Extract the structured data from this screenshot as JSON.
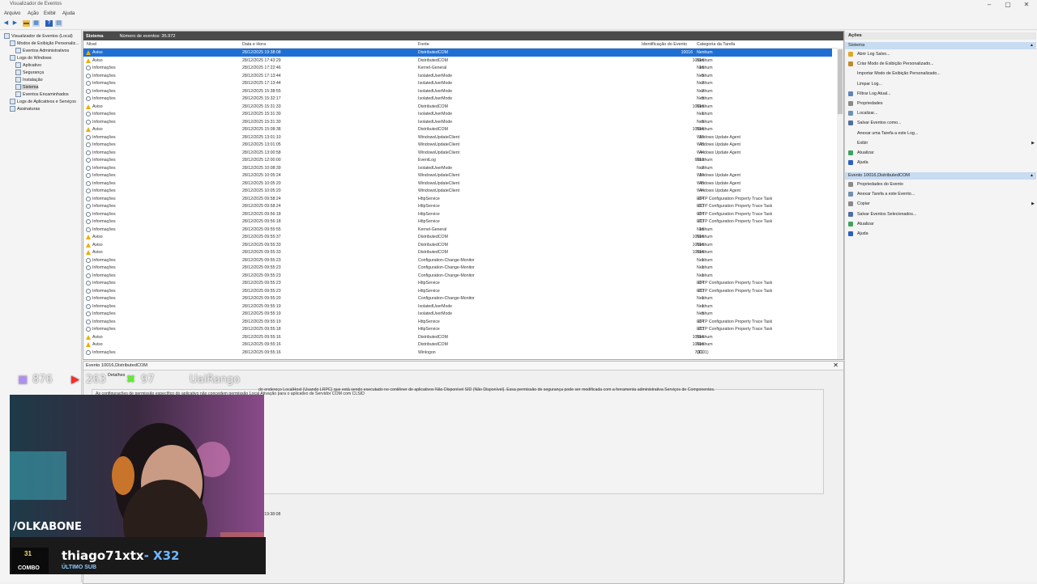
{
  "window": {
    "title": "Visualizador de Eventos",
    "controls": [
      "–",
      "▢",
      "✕"
    ]
  },
  "menu": [
    "Arquivo",
    "Ação",
    "Exibir",
    "Ajuda"
  ],
  "toolbar_icons": [
    "back-arrow-icon",
    "forward-arrow-icon",
    "folder-icon",
    "console-icon",
    "help-icon",
    "panel-icon"
  ],
  "tree": [
    {
      "label": "Visualizador de Eventos (Local)",
      "indent": 0,
      "sel": false
    },
    {
      "label": "Modos de Exibição Personaliz...",
      "indent": 1,
      "sel": false
    },
    {
      "label": "Eventos Administrativos",
      "indent": 2,
      "sel": false
    },
    {
      "label": "Logs do Windows",
      "indent": 1,
      "sel": false
    },
    {
      "label": "Aplicativo",
      "indent": 2,
      "sel": false
    },
    {
      "label": "Segurança",
      "indent": 2,
      "sel": false
    },
    {
      "label": "Instalação",
      "indent": 2,
      "sel": false
    },
    {
      "label": "Sistema",
      "indent": 2,
      "sel": true
    },
    {
      "label": "Eventos Encaminhados",
      "indent": 2,
      "sel": false
    },
    {
      "label": "Logs de Aplicativos e Serviços",
      "indent": 1,
      "sel": false
    },
    {
      "label": "Assinaturas",
      "indent": 1,
      "sel": false
    }
  ],
  "grid": {
    "log_name": "Sistema",
    "event_count": "Número de eventos: 35.972",
    "columns": [
      "Nível",
      "Data e Hora",
      "Fonte",
      "Identificação do Evento",
      "Categoria da Tarefa"
    ],
    "rows": [
      {
        "level": "Aviso",
        "type": "warn",
        "date": "28/12/2025 19:38:08",
        "source": "DistributedCOM",
        "id": "10016",
        "cat": "Nenhum",
        "sel": true
      },
      {
        "level": "Aviso",
        "type": "warn",
        "date": "28/12/2025 17:43:29",
        "source": "DistributedCOM",
        "id": "10016",
        "cat": "Nenhum"
      },
      {
        "level": "Informações",
        "type": "info",
        "date": "28/12/2025 17:22:46",
        "source": "Kernel-General",
        "id": "16",
        "cat": "Nenhum"
      },
      {
        "level": "Informações",
        "type": "info",
        "date": "28/12/2025 17:13:44",
        "source": "IsolatedUserMode",
        "id": "5",
        "cat": "Nenhum"
      },
      {
        "level": "Informações",
        "type": "info",
        "date": "28/12/2025 17:13:44",
        "source": "IsolatedUserMode",
        "id": "2",
        "cat": "Nenhum"
      },
      {
        "level": "Informações",
        "type": "info",
        "date": "28/12/2025 15:38:55",
        "source": "IsolatedUserMode",
        "id": "2",
        "cat": "Nenhum"
      },
      {
        "level": "Informações",
        "type": "info",
        "date": "28/12/2025 15:32:17",
        "source": "IsolatedUserMode",
        "id": "5",
        "cat": "Nenhum"
      },
      {
        "level": "Aviso",
        "type": "warn",
        "date": "28/12/2025 15:31:33",
        "source": "DistributedCOM",
        "id": "10016",
        "cat": "Nenhum"
      },
      {
        "level": "Informações",
        "type": "info",
        "date": "28/12/2025 15:31:30",
        "source": "IsolatedUserMode",
        "id": "1",
        "cat": "Nenhum"
      },
      {
        "level": "Informações",
        "type": "info",
        "date": "28/12/2025 15:31:30",
        "source": "IsolatedUserMode",
        "id": "5",
        "cat": "Nenhum"
      },
      {
        "level": "Aviso",
        "type": "warn",
        "date": "28/12/2025 15:08:38",
        "source": "DistributedCOM",
        "id": "10016",
        "cat": "Nenhum"
      },
      {
        "level": "Informações",
        "type": "info",
        "date": "28/12/2025 13:01:10",
        "source": "WindowsUpdateClient",
        "id": "19",
        "cat": "Windows Update Agent"
      },
      {
        "level": "Informações",
        "type": "info",
        "date": "28/12/2025 13:01:05",
        "source": "WindowsUpdateClient",
        "id": "43",
        "cat": "Windows Update Agent"
      },
      {
        "level": "Informações",
        "type": "info",
        "date": "28/12/2025 13:00:58",
        "source": "WindowsUpdateClient",
        "id": "44",
        "cat": "Windows Update Agent"
      },
      {
        "level": "Informações",
        "type": "info",
        "date": "28/12/2025 12:00:00",
        "source": "EventLog",
        "id": "6013",
        "cat": "Nenhum"
      },
      {
        "level": "Informações",
        "type": "info",
        "date": "28/12/2025 10:08:39",
        "source": "IsolatedUserMode",
        "id": "2",
        "cat": "Nenhum"
      },
      {
        "level": "Informações",
        "type": "info",
        "date": "28/12/2025 10:05:24",
        "source": "WindowsUpdateClient",
        "id": "19",
        "cat": "Windows Update Agent"
      },
      {
        "level": "Informações",
        "type": "info",
        "date": "28/12/2025 10:05:20",
        "source": "WindowsUpdateClient",
        "id": "43",
        "cat": "Windows Update Agent"
      },
      {
        "level": "Informações",
        "type": "info",
        "date": "28/12/2025 10:05:20",
        "source": "WindowsUpdateClient",
        "id": "44",
        "cat": "Windows Update Agent"
      },
      {
        "level": "Informações",
        "type": "info",
        "date": "28/12/2025 09:58:24",
        "source": "HttpService",
        "id": "114",
        "cat": "HTTP Configuration Property Trace Task"
      },
      {
        "level": "Informações",
        "type": "info",
        "date": "28/12/2025 09:58:24",
        "source": "HttpService",
        "id": "113",
        "cat": "HTTP Configuration Property Trace Task"
      },
      {
        "level": "Informações",
        "type": "info",
        "date": "28/12/2025 09:56:18",
        "source": "HttpService",
        "id": "114",
        "cat": "HTTP Configuration Property Trace Task"
      },
      {
        "level": "Informações",
        "type": "info",
        "date": "28/12/2025 09:56:18",
        "source": "HttpService",
        "id": "113",
        "cat": "HTTP Configuration Property Trace Task"
      },
      {
        "level": "Informações",
        "type": "info",
        "date": "28/12/2025 09:55:55",
        "source": "Kernel-General",
        "id": "16",
        "cat": "Nenhum"
      },
      {
        "level": "Aviso",
        "type": "warn",
        "date": "28/12/2025 09:55:37",
        "source": "DistributedCOM",
        "id": "10016",
        "cat": "Nenhum"
      },
      {
        "level": "Aviso",
        "type": "warn",
        "date": "28/12/2025 09:55:33",
        "source": "DistributedCOM",
        "id": "10016",
        "cat": "Nenhum"
      },
      {
        "level": "Aviso",
        "type": "warn",
        "date": "28/12/2025 09:55:33",
        "source": "DistributedCOM",
        "id": "10016",
        "cat": "Nenhum"
      },
      {
        "level": "Informações",
        "type": "info",
        "date": "28/12/2025 09:55:23",
        "source": "Configuration-Change-Monitor",
        "id": "1",
        "cat": "Nenhum"
      },
      {
        "level": "Informações",
        "type": "info",
        "date": "28/12/2025 09:55:23",
        "source": "Configuration-Change-Monitor",
        "id": "1",
        "cat": "Nenhum"
      },
      {
        "level": "Informações",
        "type": "info",
        "date": "28/12/2025 09:55:23",
        "source": "Configuration-Change-Monitor",
        "id": "1",
        "cat": "Nenhum"
      },
      {
        "level": "Informações",
        "type": "info",
        "date": "28/12/2025 09:55:23",
        "source": "HttpService",
        "id": "114",
        "cat": "HTTP Configuration Property Trace Task"
      },
      {
        "level": "Informações",
        "type": "info",
        "date": "28/12/2025 09:55:23",
        "source": "HttpService",
        "id": "113",
        "cat": "HTTP Configuration Property Trace Task"
      },
      {
        "level": "Informações",
        "type": "info",
        "date": "28/12/2025 09:55:20",
        "source": "Configuration-Change-Monitor",
        "id": "1",
        "cat": "Nenhum"
      },
      {
        "level": "Informações",
        "type": "info",
        "date": "28/12/2025 09:55:19",
        "source": "IsolatedUserMode",
        "id": "1",
        "cat": "Nenhum"
      },
      {
        "level": "Informações",
        "type": "info",
        "date": "28/12/2025 09:55:19",
        "source": "IsolatedUserMode",
        "id": "5",
        "cat": "Nenhum"
      },
      {
        "level": "Informações",
        "type": "info",
        "date": "28/12/2025 09:55:19",
        "source": "HttpService",
        "id": "114",
        "cat": "HTTP Configuration Property Trace Task"
      },
      {
        "level": "Informações",
        "type": "info",
        "date": "28/12/2025 09:55:18",
        "source": "HttpService",
        "id": "113",
        "cat": "HTTP Configuration Property Trace Task"
      },
      {
        "level": "Aviso",
        "type": "warn",
        "date": "28/12/2025 09:55:16",
        "source": "DistributedCOM",
        "id": "10016",
        "cat": "Nenhum"
      },
      {
        "level": "Aviso",
        "type": "warn",
        "date": "28/12/2025 09:55:16",
        "source": "DistributedCOM",
        "id": "10016",
        "cat": "Nenhum"
      },
      {
        "level": "Informações",
        "type": "info",
        "date": "28/12/2025 09:55:16",
        "source": "Winlogon",
        "id": "7001",
        "cat": "(1101)"
      }
    ]
  },
  "detail": {
    "title": "Evento 10016,DistributedCOM",
    "tab": "Detalhes",
    "text1": "As configurações de permissão específico do aplicativo não concedem permissão Local Ativação para o aplicativo de Servidor COM com CLSID",
    "text2": "do endereço LocalHost (Usando LRPC) que está sendo executado no contêiner de aplicativos Não Disponível SID (Não Disponível). Essa permissão de segurança pode ser modificada com a ferramenta administrativa Serviços de Componentes.",
    "time": "25 19:38:08"
  },
  "actions": {
    "header": "Ações",
    "section1": "Sistema",
    "items1": [
      {
        "label": "Abrir Log Salvo...",
        "icon": "folder-icon",
        "color": "#e0a826"
      },
      {
        "label": "Criar Modo de Exibição Personalizado...",
        "icon": "filter-icon",
        "color": "#c48a2a"
      },
      {
        "label": "Importar Modo de Exibição Personalizado...",
        "icon": "blank",
        "color": "transparent"
      },
      {
        "label": "Limpar Log...",
        "icon": "blank",
        "color": "transparent"
      },
      {
        "label": "Filtrar Log Atual...",
        "icon": "filter-icon",
        "color": "#5f86b5"
      },
      {
        "label": "Propriedades",
        "icon": "properties-icon",
        "color": "#8a8a8a"
      },
      {
        "label": "Localizar...",
        "icon": "find-icon",
        "color": "#7090b0"
      },
      {
        "label": "Salvar Eventos como...",
        "icon": "save-icon",
        "color": "#4f6f9f"
      },
      {
        "label": "Anexar uma Tarefa a este Log...",
        "icon": "blank",
        "color": "transparent"
      },
      {
        "label": "Exibir",
        "icon": "blank",
        "color": "transparent",
        "arrow": true
      },
      {
        "label": "Atualizar",
        "icon": "refresh-icon",
        "color": "#3ba55c"
      },
      {
        "label": "Ajuda",
        "icon": "help-icon",
        "color": "#2a5fbf"
      }
    ],
    "section2": "Evento 10016,DistributedCOM",
    "items2": [
      {
        "label": "Propriedades do Evento",
        "icon": "properties-icon",
        "color": "#8a8a8a"
      },
      {
        "label": "Anexar Tarefa a este Evento...",
        "icon": "task-icon",
        "color": "#7090b0"
      },
      {
        "label": "Copiar",
        "icon": "copy-icon",
        "color": "#8a8a8a",
        "arrow": true
      },
      {
        "label": "Salvar Eventos Selecionados...",
        "icon": "save-icon",
        "color": "#4f6f9f"
      },
      {
        "label": "Atualizar",
        "icon": "refresh-icon",
        "color": "#3ba55c"
      },
      {
        "label": "Ajuda",
        "icon": "help-icon",
        "color": "#2a5fbf"
      }
    ]
  },
  "overlay": {
    "twitch_count": "876",
    "youtube_count": "263",
    "kick_count": "97",
    "brand": "UaiRango",
    "handle": "/OLKABONE",
    "combo_num": "31",
    "combo_label": "COMBO",
    "sub_name": "thiago71xtx",
    "sub_mult": "- X32",
    "sub_label": "ÚLTIMO SUB"
  }
}
